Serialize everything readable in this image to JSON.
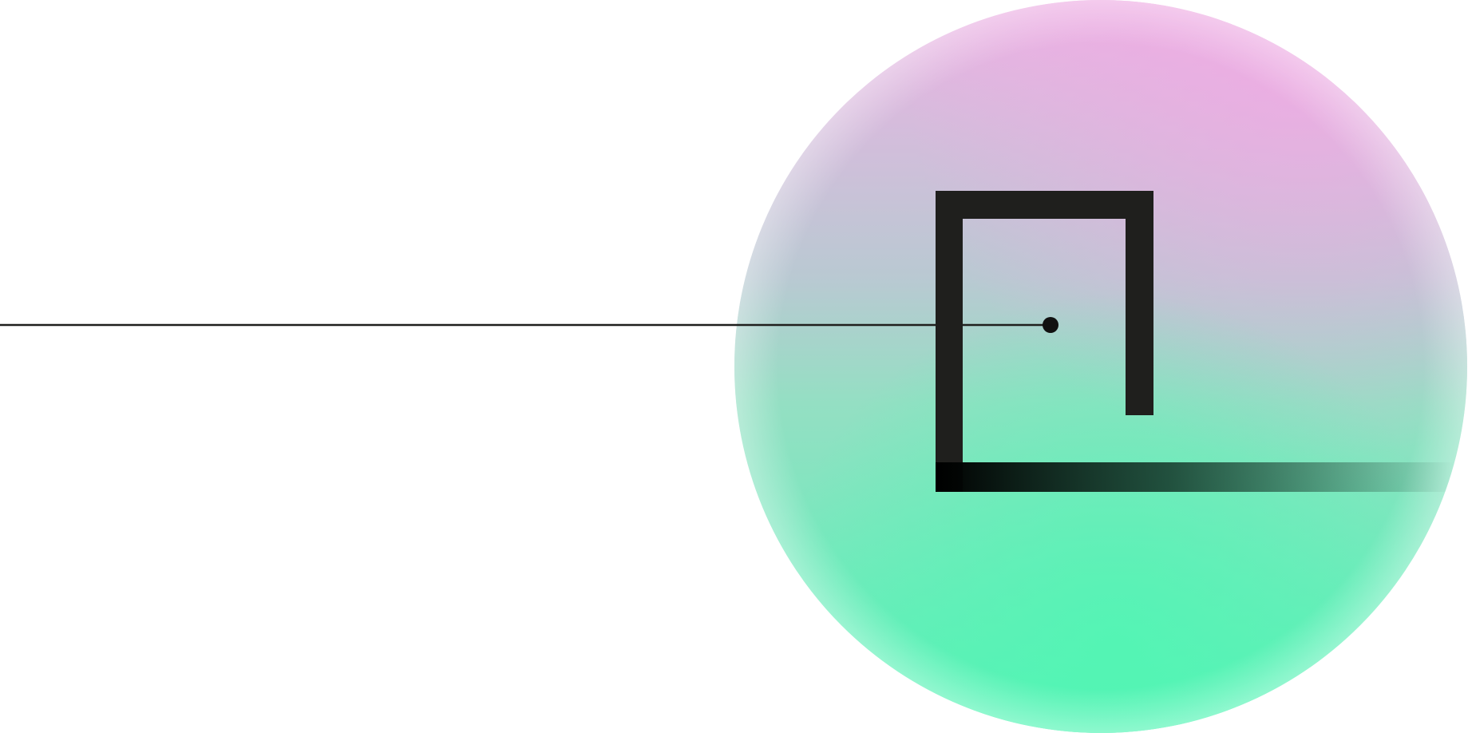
{
  "graphic": {
    "circle_colors": {
      "top": "#ecb2e4",
      "middle": "#9fded0",
      "bottom": "#50f4b6",
      "rim": "#f1f7f4"
    },
    "bracket_color": "#1f1f1d",
    "line_color": "#1f1f1d",
    "dot_color": "#111111",
    "underline_gradient": {
      "start": "#000000",
      "end": "#000000"
    }
  }
}
